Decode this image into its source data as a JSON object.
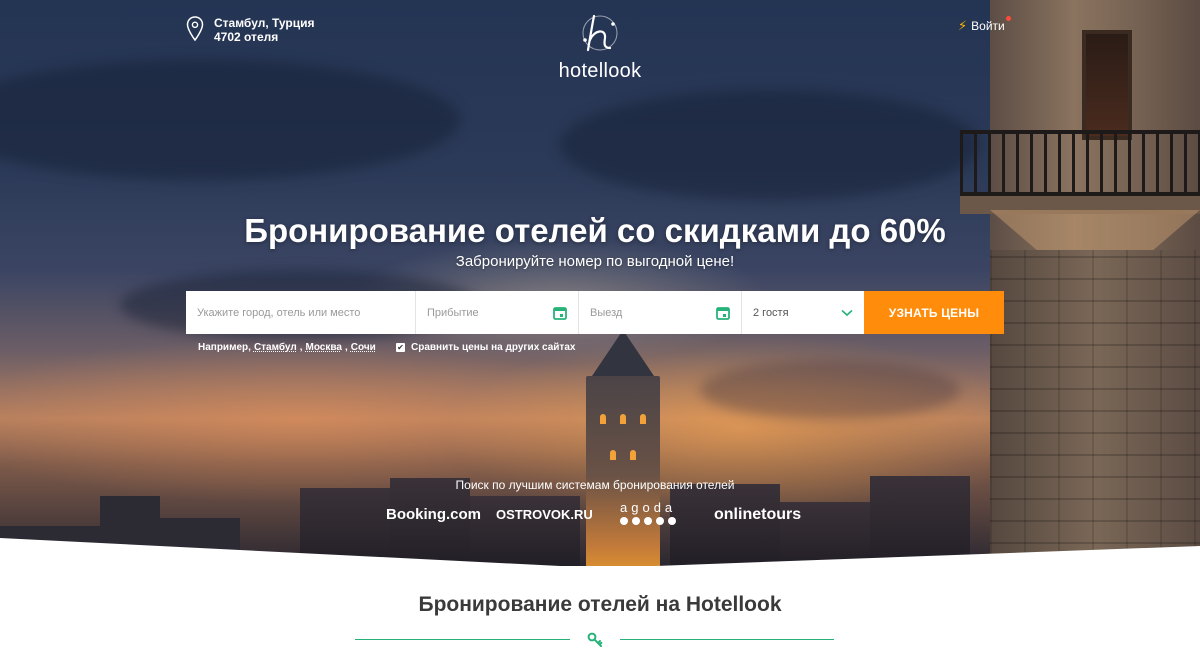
{
  "header": {
    "location_city": "Стамбул, Турция",
    "location_count": "4702 отеля",
    "logo_text": "hotellook",
    "login_label": "Войти"
  },
  "hero": {
    "title": "Бронирование отелей со скидками до 60%",
    "subtitle": "Забронируйте номер по выгодной цене!"
  },
  "search": {
    "city_placeholder": "Укажите город, отель или место",
    "checkin_placeholder": "Прибытие",
    "checkout_placeholder": "Выезд",
    "guests_value": "2 гостя",
    "submit_label": "УЗНАТЬ ЦЕНЫ",
    "examples_prefix": "Например,",
    "examples": [
      "Стамбул",
      "Москва",
      "Сочи"
    ],
    "compare_label": "Сравнить цены на других сайтах",
    "compare_checked": true
  },
  "partners": {
    "title": "Поиск по лучшим системам бронирования отелей",
    "items": [
      "Booking.com",
      "OSTROVOK.RU",
      "agoda",
      "onlinetours"
    ]
  },
  "section": {
    "title": "Бронирование отелей на Hotellook"
  },
  "colors": {
    "accent_orange": "#ff8c0a",
    "calendar_green": "#27b27a",
    "divider_green": "#27b27a"
  },
  "icons": [
    "pin-icon",
    "logo-mark-icon",
    "bolt-icon",
    "calendar-icon",
    "chevron-down-icon",
    "checkbox-icon",
    "key-icon"
  ]
}
